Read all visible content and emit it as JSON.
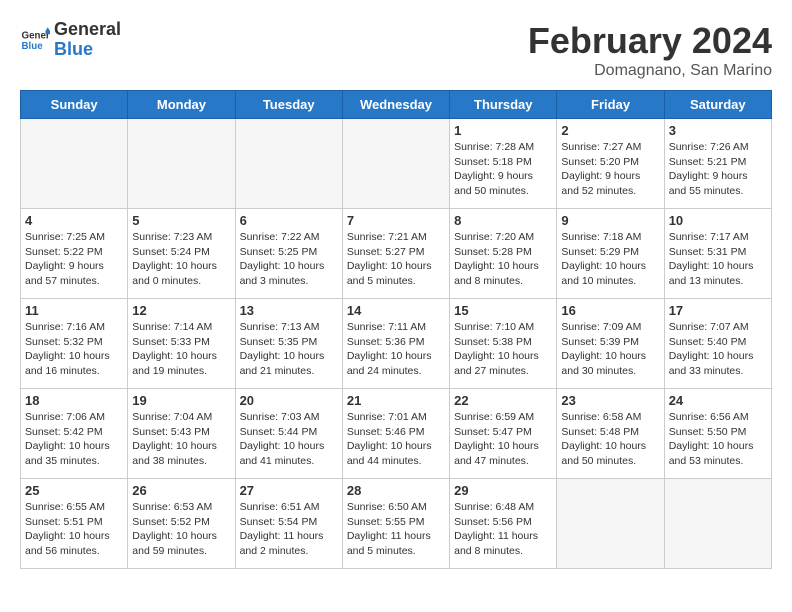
{
  "logo": {
    "line1": "General",
    "line2": "Blue"
  },
  "title": "February 2024",
  "location": "Domagnano, San Marino",
  "weekdays": [
    "Sunday",
    "Monday",
    "Tuesday",
    "Wednesday",
    "Thursday",
    "Friday",
    "Saturday"
  ],
  "weeks": [
    [
      {
        "day": "",
        "info": ""
      },
      {
        "day": "",
        "info": ""
      },
      {
        "day": "",
        "info": ""
      },
      {
        "day": "",
        "info": ""
      },
      {
        "day": "1",
        "info": "Sunrise: 7:28 AM\nSunset: 5:18 PM\nDaylight: 9 hours\nand 50 minutes."
      },
      {
        "day": "2",
        "info": "Sunrise: 7:27 AM\nSunset: 5:20 PM\nDaylight: 9 hours\nand 52 minutes."
      },
      {
        "day": "3",
        "info": "Sunrise: 7:26 AM\nSunset: 5:21 PM\nDaylight: 9 hours\nand 55 minutes."
      }
    ],
    [
      {
        "day": "4",
        "info": "Sunrise: 7:25 AM\nSunset: 5:22 PM\nDaylight: 9 hours\nand 57 minutes."
      },
      {
        "day": "5",
        "info": "Sunrise: 7:23 AM\nSunset: 5:24 PM\nDaylight: 10 hours\nand 0 minutes."
      },
      {
        "day": "6",
        "info": "Sunrise: 7:22 AM\nSunset: 5:25 PM\nDaylight: 10 hours\nand 3 minutes."
      },
      {
        "day": "7",
        "info": "Sunrise: 7:21 AM\nSunset: 5:27 PM\nDaylight: 10 hours\nand 5 minutes."
      },
      {
        "day": "8",
        "info": "Sunrise: 7:20 AM\nSunset: 5:28 PM\nDaylight: 10 hours\nand 8 minutes."
      },
      {
        "day": "9",
        "info": "Sunrise: 7:18 AM\nSunset: 5:29 PM\nDaylight: 10 hours\nand 10 minutes."
      },
      {
        "day": "10",
        "info": "Sunrise: 7:17 AM\nSunset: 5:31 PM\nDaylight: 10 hours\nand 13 minutes."
      }
    ],
    [
      {
        "day": "11",
        "info": "Sunrise: 7:16 AM\nSunset: 5:32 PM\nDaylight: 10 hours\nand 16 minutes."
      },
      {
        "day": "12",
        "info": "Sunrise: 7:14 AM\nSunset: 5:33 PM\nDaylight: 10 hours\nand 19 minutes."
      },
      {
        "day": "13",
        "info": "Sunrise: 7:13 AM\nSunset: 5:35 PM\nDaylight: 10 hours\nand 21 minutes."
      },
      {
        "day": "14",
        "info": "Sunrise: 7:11 AM\nSunset: 5:36 PM\nDaylight: 10 hours\nand 24 minutes."
      },
      {
        "day": "15",
        "info": "Sunrise: 7:10 AM\nSunset: 5:38 PM\nDaylight: 10 hours\nand 27 minutes."
      },
      {
        "day": "16",
        "info": "Sunrise: 7:09 AM\nSunset: 5:39 PM\nDaylight: 10 hours\nand 30 minutes."
      },
      {
        "day": "17",
        "info": "Sunrise: 7:07 AM\nSunset: 5:40 PM\nDaylight: 10 hours\nand 33 minutes."
      }
    ],
    [
      {
        "day": "18",
        "info": "Sunrise: 7:06 AM\nSunset: 5:42 PM\nDaylight: 10 hours\nand 35 minutes."
      },
      {
        "day": "19",
        "info": "Sunrise: 7:04 AM\nSunset: 5:43 PM\nDaylight: 10 hours\nand 38 minutes."
      },
      {
        "day": "20",
        "info": "Sunrise: 7:03 AM\nSunset: 5:44 PM\nDaylight: 10 hours\nand 41 minutes."
      },
      {
        "day": "21",
        "info": "Sunrise: 7:01 AM\nSunset: 5:46 PM\nDaylight: 10 hours\nand 44 minutes."
      },
      {
        "day": "22",
        "info": "Sunrise: 6:59 AM\nSunset: 5:47 PM\nDaylight: 10 hours\nand 47 minutes."
      },
      {
        "day": "23",
        "info": "Sunrise: 6:58 AM\nSunset: 5:48 PM\nDaylight: 10 hours\nand 50 minutes."
      },
      {
        "day": "24",
        "info": "Sunrise: 6:56 AM\nSunset: 5:50 PM\nDaylight: 10 hours\nand 53 minutes."
      }
    ],
    [
      {
        "day": "25",
        "info": "Sunrise: 6:55 AM\nSunset: 5:51 PM\nDaylight: 10 hours\nand 56 minutes."
      },
      {
        "day": "26",
        "info": "Sunrise: 6:53 AM\nSunset: 5:52 PM\nDaylight: 10 hours\nand 59 minutes."
      },
      {
        "day": "27",
        "info": "Sunrise: 6:51 AM\nSunset: 5:54 PM\nDaylight: 11 hours\nand 2 minutes."
      },
      {
        "day": "28",
        "info": "Sunrise: 6:50 AM\nSunset: 5:55 PM\nDaylight: 11 hours\nand 5 minutes."
      },
      {
        "day": "29",
        "info": "Sunrise: 6:48 AM\nSunset: 5:56 PM\nDaylight: 11 hours\nand 8 minutes."
      },
      {
        "day": "",
        "info": ""
      },
      {
        "day": "",
        "info": ""
      }
    ]
  ]
}
